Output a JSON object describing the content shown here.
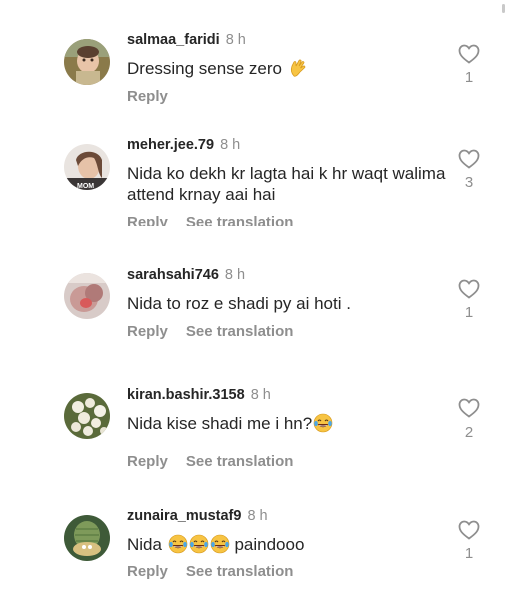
{
  "comments": [
    {
      "username": "salmaa_faridi",
      "time": "8 h",
      "text": "Dressing sense zero",
      "emoji": "clapping-hands-emoji",
      "reply_label": "Reply",
      "likes": "1"
    },
    {
      "username": "meher.jee.79",
      "time": "8 h",
      "text": "Nida ko dekh kr lagta hai k hr waqt walima attend krnay aai hai",
      "avatar_caption": "MOM",
      "reply_label": "Reply",
      "translate_label": "See translation",
      "likes": "3"
    },
    {
      "username": "sarahsahi746",
      "time": "8 h",
      "text": "Nida to roz e shadi py ai hoti .",
      "reply_label": "Reply",
      "translate_label": "See translation",
      "likes": "1"
    },
    {
      "username": "kiran.bashir.3158",
      "time": "8 h",
      "text": "Nida kise shadi me i hn?",
      "emoji": "tears-of-joy-emoji",
      "reply_label": "Reply",
      "translate_label": "See translation",
      "likes": "2"
    },
    {
      "username": "zunaira_mustaf9",
      "time": "8 h",
      "text_before": "Nida",
      "emojis": [
        "tears-of-joy-emoji",
        "tears-of-joy-emoji",
        "tears-of-joy-emoji"
      ],
      "text_after": "paindooo",
      "reply_label": "Reply",
      "translate_label": "See translation",
      "likes": "1"
    }
  ],
  "colors": {
    "text_primary": "#262626",
    "text_secondary": "#8e8e8e",
    "background": "#ffffff"
  },
  "icons": {
    "like": "heart-outline-icon"
  }
}
